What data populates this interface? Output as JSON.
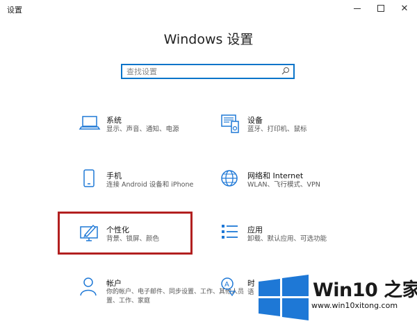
{
  "window": {
    "title": "设置"
  },
  "header": {
    "title": "Windows 设置"
  },
  "search": {
    "placeholder": "查找设置"
  },
  "tiles": [
    {
      "title": "系统",
      "desc": "显示、声音、通知、电源",
      "icon": "laptop-icon"
    },
    {
      "title": "设备",
      "desc": "蓝牙、打印机、鼠标",
      "icon": "devices-icon"
    },
    {
      "title": "手机",
      "desc": "连接 Android 设备和 iPhone",
      "icon": "phone-icon"
    },
    {
      "title": "网络和 Internet",
      "desc": "WLAN、飞行模式、VPN",
      "icon": "globe-icon"
    },
    {
      "title": "个性化",
      "desc": "背景、锁屏、颜色",
      "icon": "personalization-icon"
    },
    {
      "title": "应用",
      "desc": "卸载、默认应用、可选功能",
      "icon": "apps-list-icon"
    },
    {
      "title": "帐户",
      "desc": "你的帐户、电子邮件、同步设置、工作、其他人员",
      "desc2": "置、工作、家庭",
      "icon": "person-icon"
    },
    {
      "title": "时",
      "desc": "语",
      "icon": "time-language-icon"
    }
  ],
  "watermark": {
    "brand": "Win10 之家",
    "url": "www.win10xitong.com"
  },
  "colors": {
    "accent": "#0a74c9",
    "highlight": "#b21f1f",
    "logo_blue": "#1e78d6"
  }
}
